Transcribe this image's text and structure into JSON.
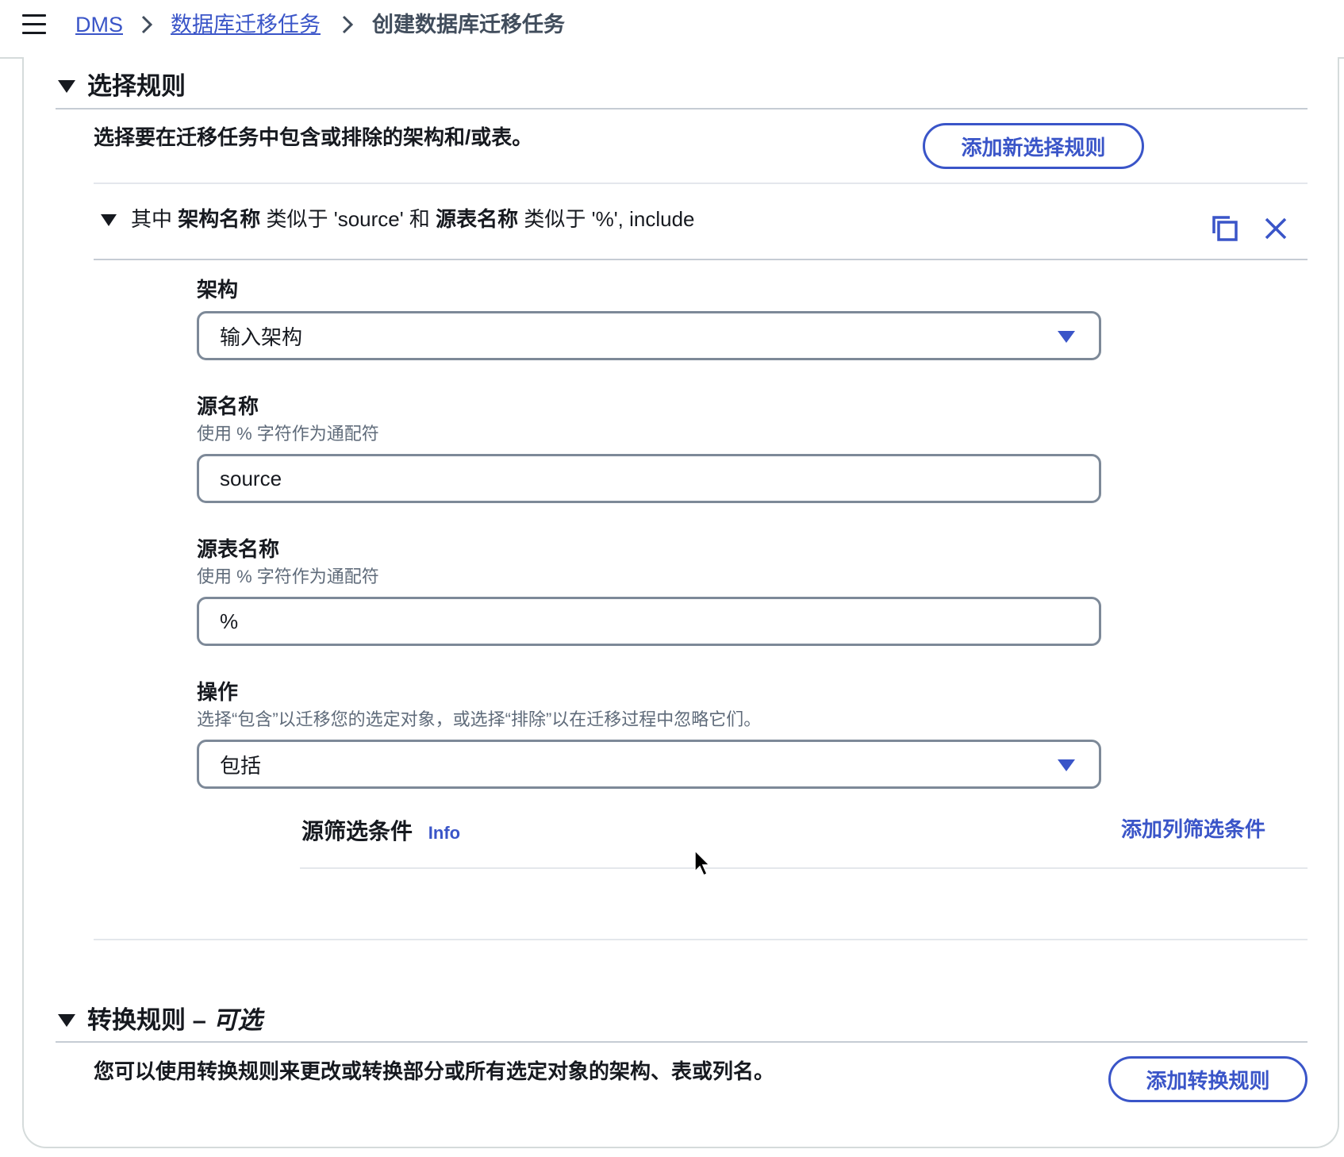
{
  "breadcrumb": {
    "items": [
      {
        "label": "DMS"
      },
      {
        "label": "数据库迁移任务"
      },
      {
        "label": "创建数据库迁移任务"
      }
    ]
  },
  "selection_rules": {
    "title": "选择规则",
    "description": "选择要在迁移任务中包含或排除的架构和/或表。",
    "add_button": "添加新选择规则",
    "rule": {
      "summary_prefix": "其中",
      "summary_schema_label": "架构名称",
      "summary_schema_like": "类似于 'source' 和",
      "summary_table_label": "源表名称",
      "summary_table_like": "类似于 '%', include",
      "schema": {
        "label": "架构",
        "placeholder": "输入架构"
      },
      "source_name": {
        "label": "源名称",
        "hint": "使用 % 字符作为通配符",
        "value": "source"
      },
      "source_table_name": {
        "label": "源表名称",
        "hint": "使用 % 字符作为通配符",
        "value": "%"
      },
      "action": {
        "label": "操作",
        "hint": "选择“包含”以迁移您的选定对象，或选择“排除”以在迁移过程中忽略它们。",
        "value": "包括"
      },
      "source_filter": {
        "title": "源筛选条件",
        "info_link": "Info",
        "add_link": "添加列筛选条件"
      }
    }
  },
  "transformation_rules": {
    "title": "转换规则 –",
    "title_optional": "可选",
    "description": "您可以使用转换规则来更改或转换部分或所有选定对象的架构、表或列名。",
    "add_button": "添加转换规则"
  },
  "colors": {
    "accent": "#3a55c8",
    "text": "#16191f",
    "border": "#7d8998"
  }
}
